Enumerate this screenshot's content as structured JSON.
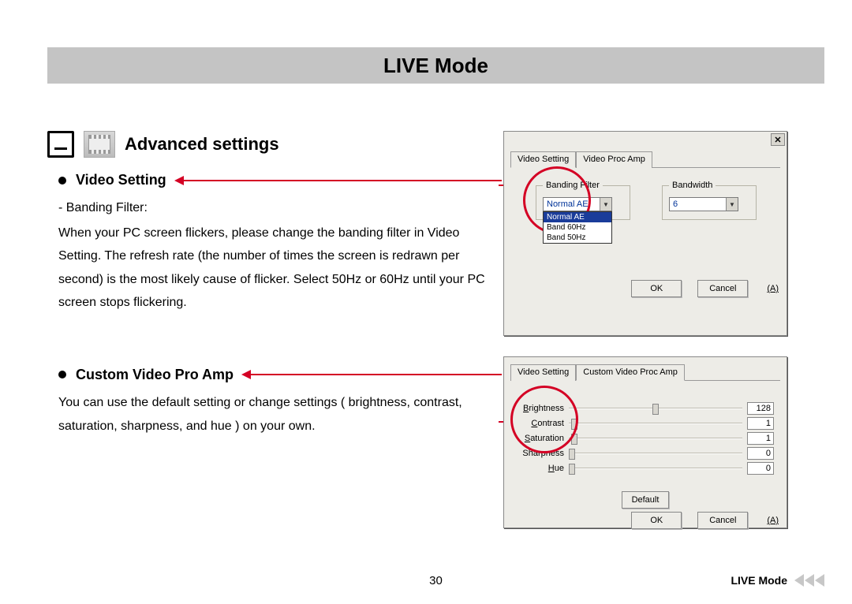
{
  "page_title": "LIVE Mode",
  "advanced_heading": "Advanced settings",
  "section1": {
    "heading": "Video Setting",
    "sub": "- Banding Filter:",
    "body": "When your PC screen flickers, please change the banding filter in Video Setting. The refresh rate (the number of times the screen is redrawn per second) is the most likely cause of flicker. Select  50Hz or 60Hz until your PC screen stops flickering."
  },
  "section2": {
    "heading": "Custom Video Pro Amp",
    "body": "You can use the default setting or change settings ( brightness, contrast, saturation, sharpness, and hue ) on your own."
  },
  "dialog1": {
    "tabs": [
      "Video Setting",
      "Video Proc Amp"
    ],
    "group_banding": "Banding Filter",
    "group_bandwidth": "Bandwidth",
    "banding_selected": "Normal AE",
    "banding_options": [
      "Normal AE",
      "Band 60Hz",
      "Band 50Hz"
    ],
    "bandwidth_selected": "6",
    "ok": "OK",
    "cancel": "Cancel",
    "apply_hint": "(A)"
  },
  "dialog2": {
    "tabs": [
      "Video Setting",
      "Custom Video Proc Amp"
    ],
    "sliders": [
      {
        "label": "Brightness",
        "u": "B",
        "pos": 50,
        "value": "128"
      },
      {
        "label": "Contrast",
        "u": "C",
        "pos": 3,
        "value": "1"
      },
      {
        "label": "Saturation",
        "u": "S",
        "pos": 3,
        "value": "1"
      },
      {
        "label": "Sharpness",
        "u": "",
        "pos": 2,
        "value": "0"
      },
      {
        "label": "Hue",
        "u": "H",
        "pos": 2,
        "value": "0"
      }
    ],
    "default_btn": "Default",
    "ok": "OK",
    "cancel": "Cancel",
    "apply_hint": "(A)"
  },
  "footer": {
    "page_number": "30",
    "section": "LIVE Mode"
  }
}
